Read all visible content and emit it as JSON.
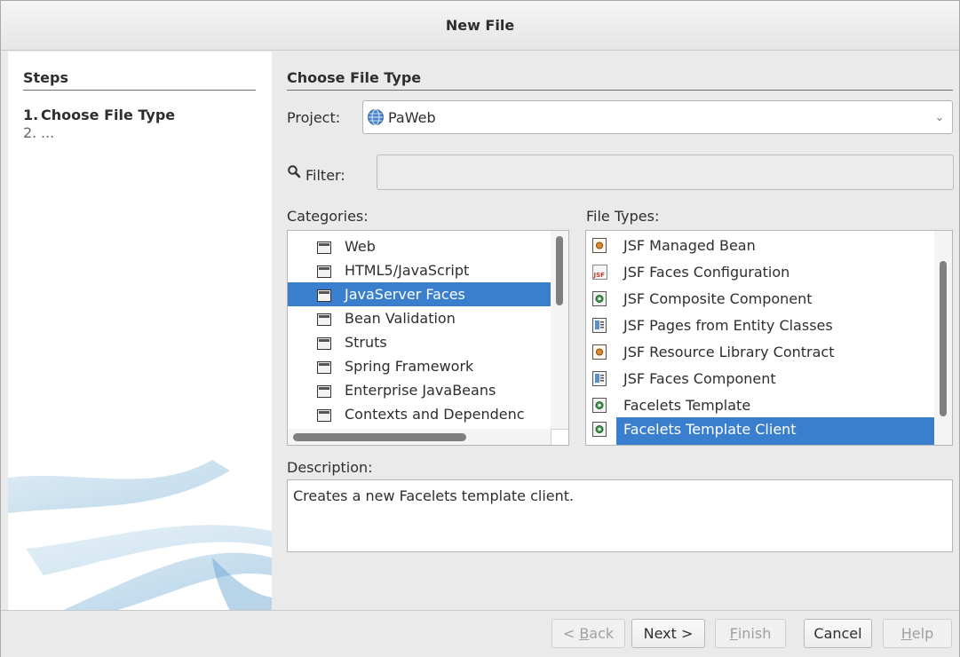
{
  "window": {
    "title": "New File"
  },
  "steps": {
    "title": "Steps",
    "items": [
      {
        "num": "1.",
        "label": "Choose File Type"
      },
      {
        "num": "2.",
        "label": "..."
      }
    ]
  },
  "main": {
    "title": "Choose File Type",
    "project_label": "Project:",
    "project_value": "PaWeb",
    "filter_label": "Filter:",
    "filter_value": "",
    "categories_label": "Categories:",
    "categories": [
      "Web",
      "HTML5/JavaScript",
      "JavaServer Faces",
      "Bean Validation",
      "Struts",
      "Spring Framework",
      "Enterprise JavaBeans",
      "Contexts and Dependenc"
    ],
    "selected_category": "JavaServer Faces",
    "file_types_label": "File Types:",
    "file_types": [
      {
        "label": "JSF Managed Bean",
        "icon": "bean-icon"
      },
      {
        "label": "JSF Faces Configuration",
        "icon": "jsf-config-icon"
      },
      {
        "label": "JSF Composite Component",
        "icon": "facelet-icon"
      },
      {
        "label": "JSF Pages from Entity Classes",
        "icon": "pages-icon"
      },
      {
        "label": "JSF Resource Library Contract",
        "icon": "bean-icon"
      },
      {
        "label": "JSF Faces Component",
        "icon": "pages-icon"
      },
      {
        "label": "Facelets Template",
        "icon": "facelet-icon"
      },
      {
        "label": "Facelets Template Client",
        "icon": "facelet-icon"
      }
    ],
    "selected_file_type": "Facelets Template Client",
    "description_label": "Description:",
    "description_text": "Creates a new Facelets template client."
  },
  "buttons": {
    "back": {
      "pre": "< ",
      "mnemonic": "B",
      "post": "ack"
    },
    "next": "Next >",
    "finish": {
      "mnemonic": "F",
      "post": "inish"
    },
    "cancel": "Cancel",
    "help": {
      "mnemonic": "H",
      "post": "elp"
    }
  },
  "colors": {
    "selection": "#3a7fce",
    "panel_bg": "#eaeaea"
  }
}
